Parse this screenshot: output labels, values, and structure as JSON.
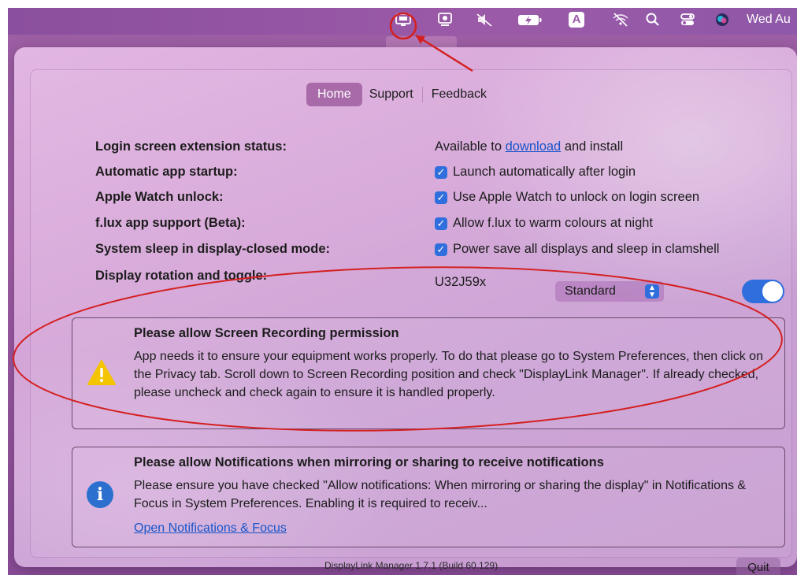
{
  "menubar": {
    "icons": [
      "displaylink-icon",
      "screen-mirroring-icon",
      "volume-muted-icon",
      "battery-charging-icon",
      "input-source-icon",
      "wifi-off-icon",
      "spotlight-search-icon",
      "control-center-icon",
      "siri-icon"
    ],
    "input_source": "A",
    "clock": "Wed Au"
  },
  "tabs": {
    "home": "Home",
    "support": "Support",
    "feedback": "Feedback"
  },
  "settings": {
    "login_ext_label": "Login screen extension status:",
    "login_ext_prefix": "Available to ",
    "login_ext_link": "download",
    "login_ext_suffix": " and install",
    "startup_label": "Automatic app startup:",
    "startup_value": "Launch automatically after login",
    "watch_label": "Apple Watch unlock:",
    "watch_value": "Use Apple Watch to unlock on login screen",
    "flux_label": "f.lux app support (Beta):",
    "flux_value": "Allow f.lux to warm colours at night",
    "sleep_label": "System sleep in display-closed mode:",
    "sleep_value": "Power save all displays and sleep in clamshell",
    "rotation_label": "Display rotation and toggle:",
    "display_name": "U32J59x",
    "rotation_option": "Standard",
    "toggle_on": true
  },
  "alerts": {
    "screen_title": "Please allow Screen Recording permission",
    "screen_text": "App needs it to ensure your equipment works properly. To do that please go to System Preferences, then click on the Privacy tab. Scroll down to Screen Recording position and check \"DisplayLink Manager\". If already checked, please uncheck and check again to ensure it is handled properly.",
    "notif_title": "Please allow Notifications when mirroring or sharing to receive notifications",
    "notif_text": "Please ensure you have checked \"Allow notifications: When mirroring or sharing the display\" in Notifications & Focus in System Preferences. Enabling it is required to receiv...",
    "notif_link": "Open Notifications & Focus"
  },
  "footer": {
    "version": "DisplayLink Manager 1.7.1 (Build 60.129)",
    "quit": "Quit"
  },
  "colors": {
    "accent": "#2f6fdd",
    "annotation": "#d42020",
    "tab_active": "#a86aa8"
  }
}
